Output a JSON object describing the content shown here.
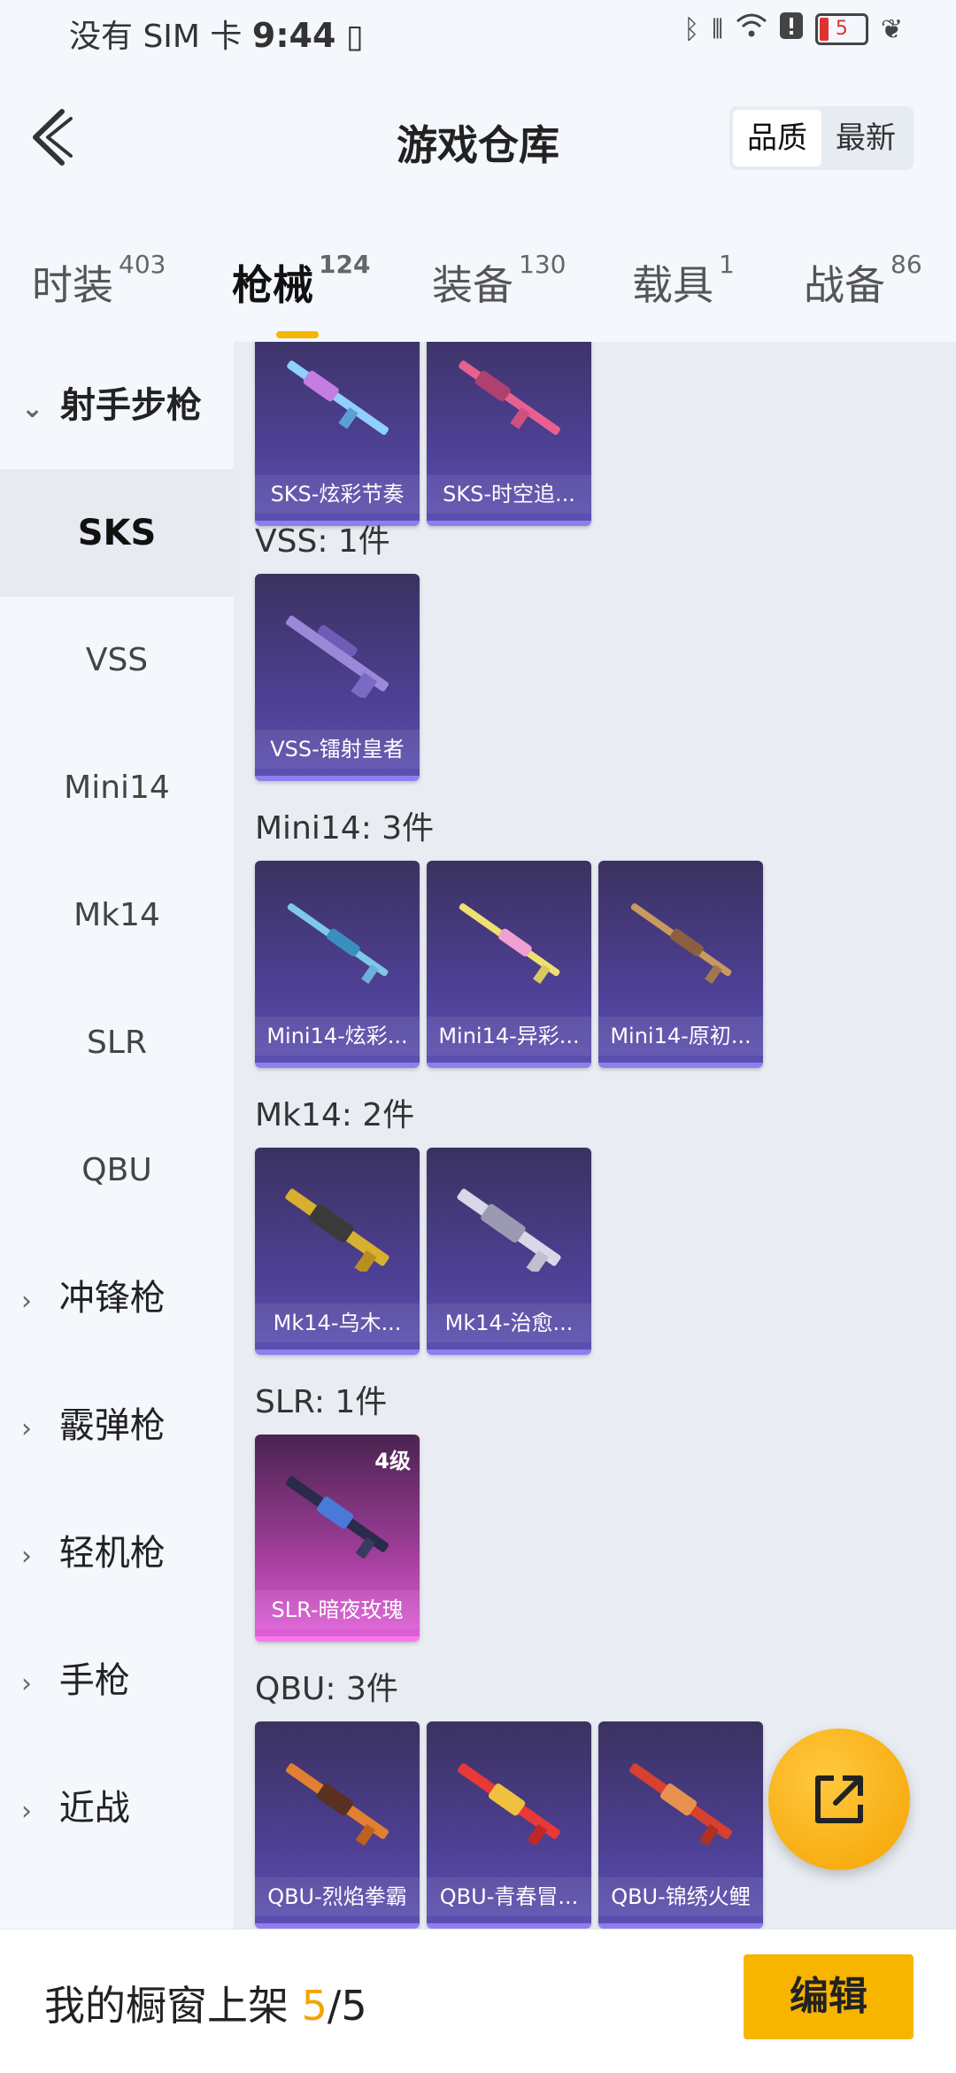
{
  "status_bar": {
    "carrier": "没有 SIM 卡",
    "time": "9:44",
    "battery": "5"
  },
  "header": {
    "title": "游戏仓库",
    "sort_options": [
      "品质",
      "最新"
    ],
    "sort_selected": "品质"
  },
  "tabs": [
    {
      "label": "时装",
      "count": "403"
    },
    {
      "label": "枪械",
      "count": "124"
    },
    {
      "label": "装备",
      "count": "130"
    },
    {
      "label": "载具",
      "count": "1"
    },
    {
      "label": "战备",
      "count": "86"
    }
  ],
  "active_tab": "枪械",
  "sidebar": {
    "open_category": "射手步枪",
    "subitems": [
      "SKS",
      "VSS",
      "Mini14",
      "Mk14",
      "SLR",
      "QBU"
    ],
    "active_subitem": "SKS",
    "categories": [
      "冲锋枪",
      "霰弹枪",
      "轻机枪",
      "手枪",
      "近战"
    ]
  },
  "groups": {
    "sks": {
      "items": [
        "SKS-炫彩节奏",
        "SKS-时空追..."
      ]
    },
    "vss": {
      "title": "VSS: 1件",
      "items": [
        "VSS-镭射皇者"
      ]
    },
    "mini14": {
      "title": "Mini14: 3件",
      "items": [
        "Mini14-炫彩...",
        "Mini14-异彩...",
        "Mini14-原初..."
      ]
    },
    "mk14": {
      "title": "Mk14: 2件",
      "items": [
        "Mk14-乌木...",
        "Mk14-治愈..."
      ]
    },
    "slr": {
      "title": "SLR: 1件",
      "items": [
        "SLR-暗夜玫瑰"
      ],
      "level": "4级"
    },
    "qbu": {
      "title": "QBU: 3件",
      "items": [
        "QBU-烈焰拳霸",
        "QBU-青春冒...",
        "QBU-锦绣火鲤"
      ]
    }
  },
  "bottom": {
    "shelf_label": "我的橱窗上架",
    "shelf_current": "5",
    "shelf_total": "/5",
    "edit_label": "编辑"
  },
  "colors": {
    "accent": "#f7b500",
    "card_purple": "#4d3f92",
    "card_pink": "#a23e9b"
  }
}
